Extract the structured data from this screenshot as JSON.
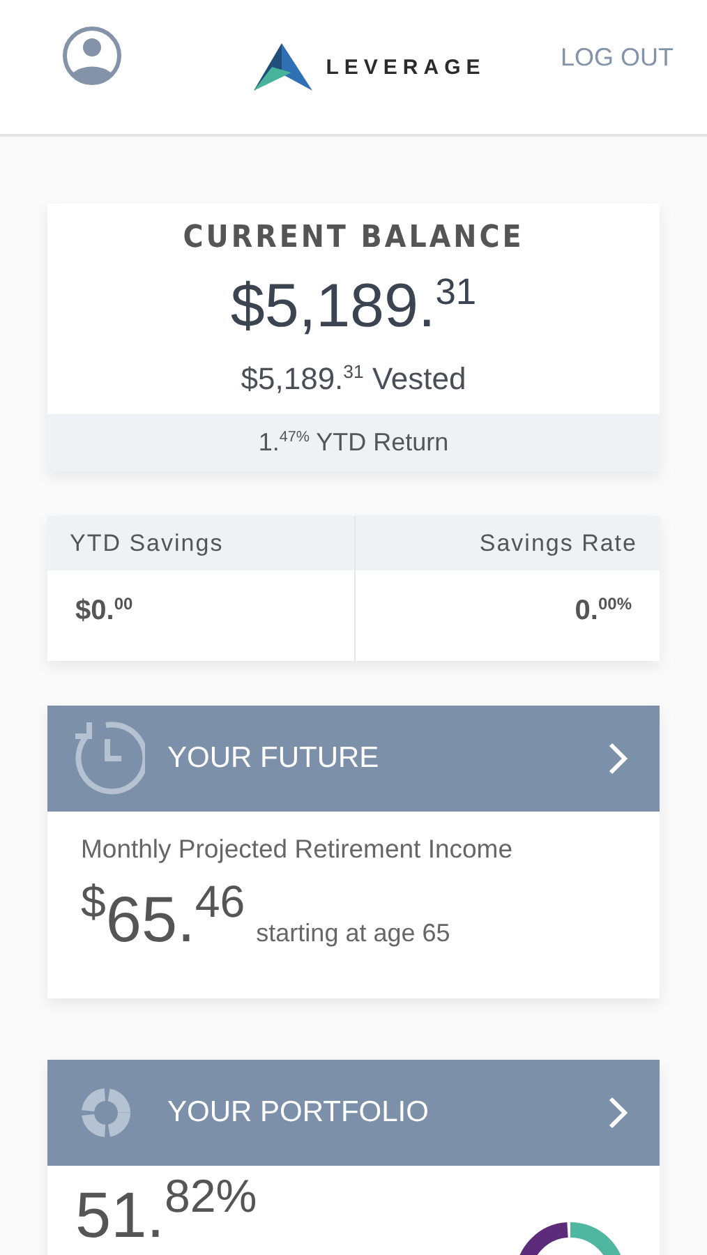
{
  "header": {
    "logo_text": "LEVERAGE",
    "logout": "LOG OUT"
  },
  "balance": {
    "title": "CURRENT BALANCE",
    "amount": "$5,189.$^{31}$",
    "vested": "$5,189.$^{31}$ Vested",
    "ytd_return": "1.$^{47%}$ YTD Return"
  },
  "stats": [
    {
      "label": "YTD Savings",
      "value": "$0.$^{00}$"
    },
    {
      "label": "Savings Rate",
      "value": "0.$^{00%}$"
    }
  ],
  "future": {
    "title": "YOUR FUTURE",
    "caption": "Monthly Projected Retirement Income",
    "amount": "$^{$}$65.$^{46}$",
    "note": "starting at age 65"
  },
  "portfolio": {
    "title": "YOUR PORTFOLIO",
    "amount": "51.$^{82%}$"
  }
}
